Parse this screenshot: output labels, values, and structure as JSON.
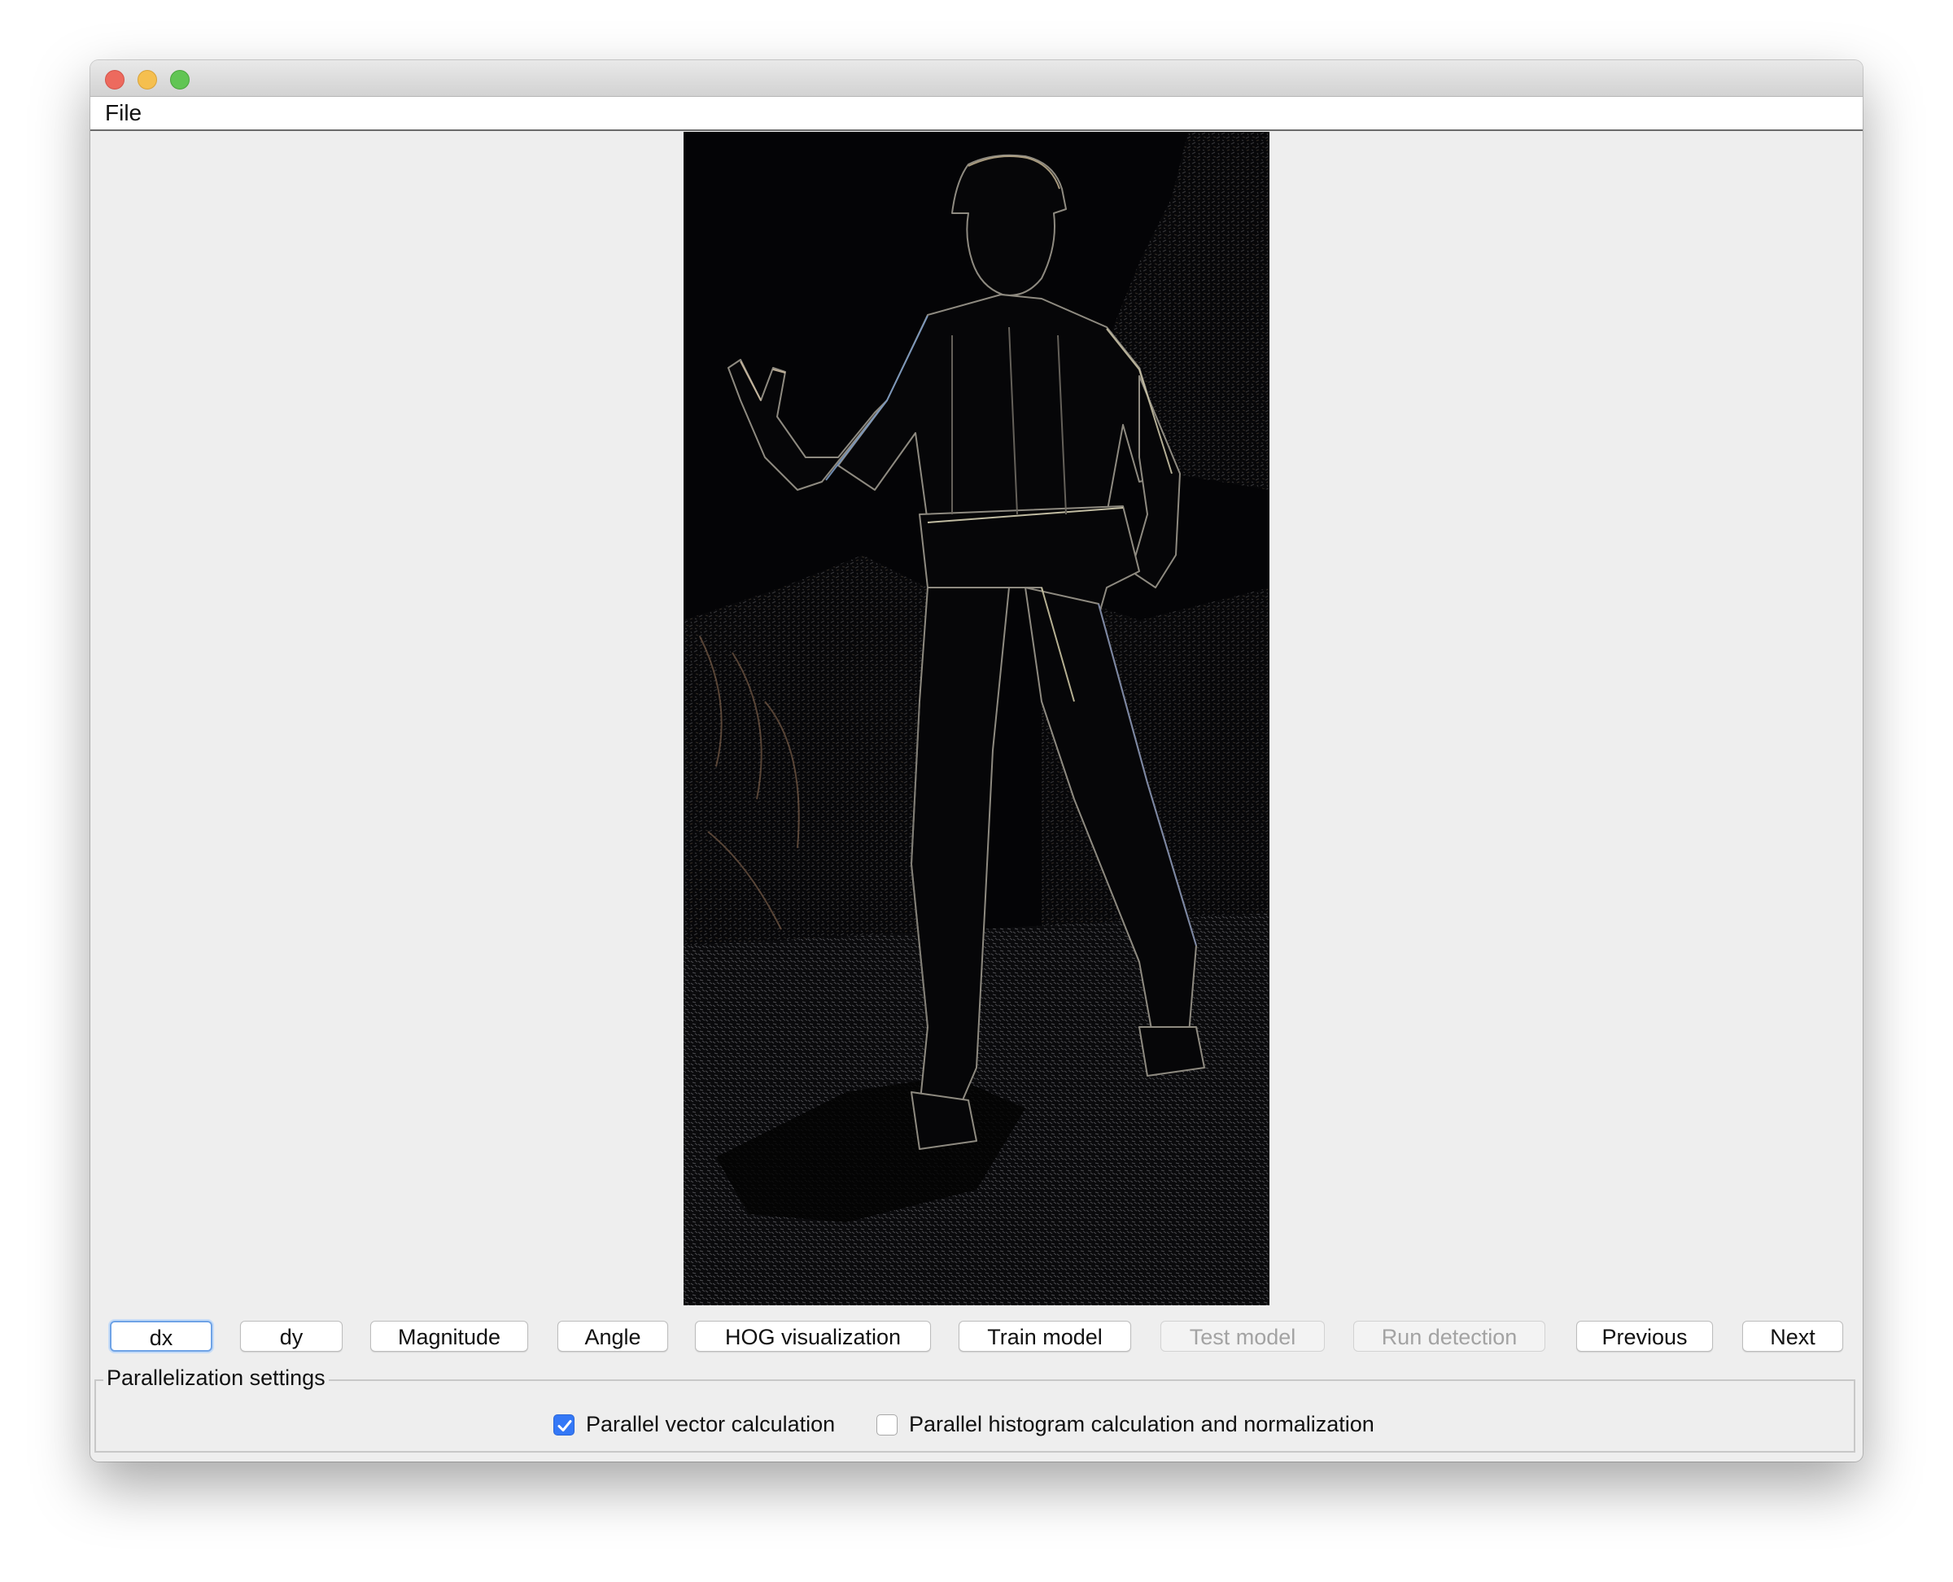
{
  "menu": {
    "file_label": "File"
  },
  "image_panel": {
    "view_mode": "dx gradient"
  },
  "buttons": {
    "dx": "dx",
    "dy": "dy",
    "magnitude": "Magnitude",
    "angle": "Angle",
    "hog_visualization": "HOG visualization",
    "train_model": "Train model",
    "test_model": "Test model",
    "run_detection": "Run detection",
    "previous": "Previous",
    "next": "Next"
  },
  "parallelization": {
    "title": "Parallelization settings",
    "parallel_vector": {
      "label": "Parallel vector calculation",
      "checked": true
    },
    "parallel_histogram": {
      "label": "Parallel histogram calculation and normalization",
      "checked": false
    }
  },
  "colors": {
    "accent": "#3478f6",
    "focus_ring": "#6fa3e6",
    "close": "#ed6a5e",
    "minimize": "#f5bf4f",
    "zoom": "#61c554"
  }
}
